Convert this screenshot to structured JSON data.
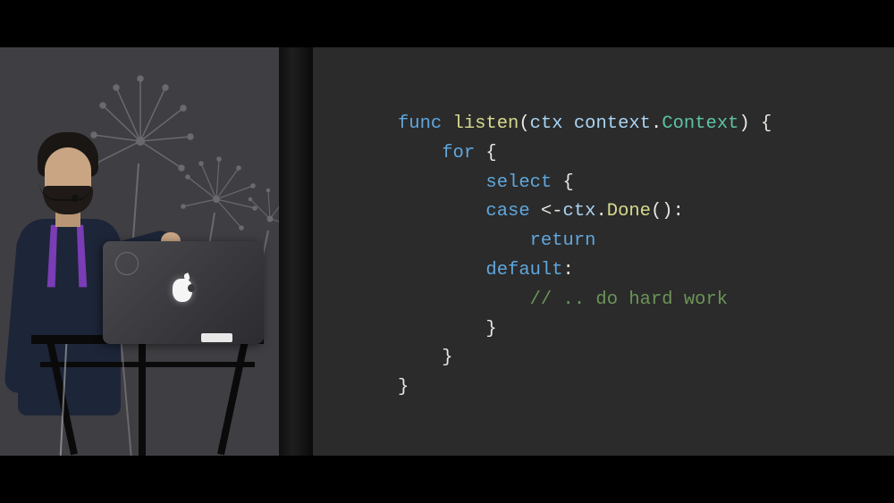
{
  "code": {
    "l1_func": "func",
    "l1_name": "listen",
    "l1_open": "(",
    "l1_arg": "ctx",
    "l1_space": " ",
    "l1_pkg": "context",
    "l1_dot": ".",
    "l1_type": "Context",
    "l1_close": ") {",
    "l2_for": "for",
    "l2_brace": " {",
    "l3_select": "select",
    "l3_brace": " {",
    "l4_case": "case",
    "l4_recv": " <-",
    "l4_ctx": "ctx",
    "l4_dot": ".",
    "l4_done": "Done",
    "l4_colon": "():",
    "l5_return": "return",
    "l6_default": "default",
    "l6_colon": ":",
    "l7_comment": "// .. do hard work",
    "l8_brace": "}",
    "l9_brace": "}",
    "l10_brace": "}"
  }
}
